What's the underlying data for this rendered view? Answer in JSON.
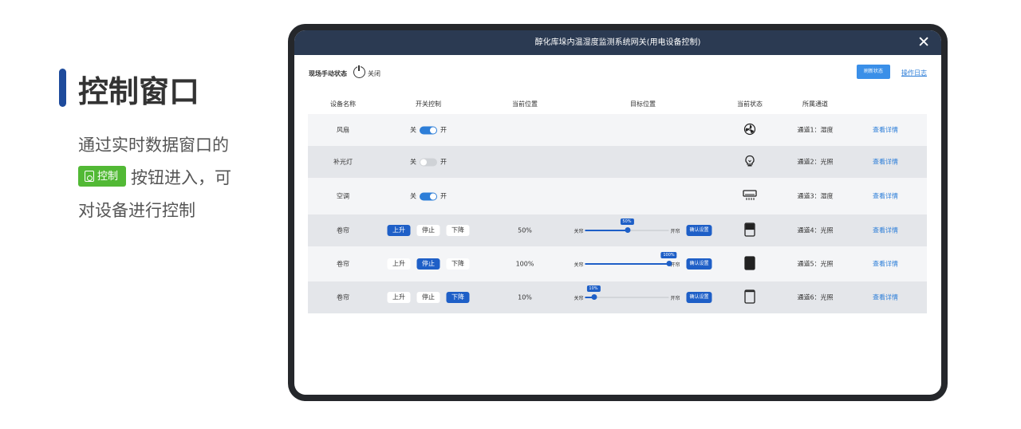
{
  "intro": {
    "title": "控制窗口",
    "line1": "通过实时数据窗口的",
    "badge_label": "控制",
    "line2_rest": "按钮进入，可",
    "line3": "对设备进行控制"
  },
  "window": {
    "title": "醇化库垛内温湿度监测系统网关(用电设备控制)",
    "close_icon": "close-icon"
  },
  "toolbar": {
    "mode_label": "现场手动状态",
    "mode_value": "关闭",
    "refresh_label": "刷新状态",
    "log_label": "操作日志"
  },
  "table": {
    "headers": [
      "设备名称",
      "开关控制",
      "当前位置",
      "目标位置",
      "当前状态",
      "所属通道"
    ],
    "rows": [
      {
        "name": "风扇",
        "type": "switch",
        "off": "关",
        "on": "开",
        "switch_on": true,
        "icon": "fan-icon",
        "channel": "通道1：湿度",
        "detail": "查看详情"
      },
      {
        "name": "补光灯",
        "type": "switch",
        "off": "关",
        "on": "开",
        "switch_on": false,
        "icon": "bulb-icon",
        "channel": "通道2：光照",
        "detail": "查看详情"
      },
      {
        "name": "空调",
        "type": "switch",
        "off": "关",
        "on": "开",
        "switch_on": true,
        "icon": "aircon-icon",
        "channel": "通道3：湿度",
        "detail": "查看详情"
      },
      {
        "name": "卷帘",
        "type": "curtain",
        "up": "上升",
        "stop": "停止",
        "down": "下降",
        "active": "up",
        "position": "50%",
        "target_percent": 50,
        "tip": "50%",
        "close_label": "关帘",
        "open_label": "开帘",
        "confirm": "确认设置",
        "icon": "curtain-half-icon",
        "channel": "通道4：光照",
        "detail": "查看详情"
      },
      {
        "name": "卷帘",
        "type": "curtain",
        "up": "上升",
        "stop": "停止",
        "down": "下降",
        "active": "stop",
        "position": "100%",
        "target_percent": 100,
        "tip": "100%",
        "close_label": "关帘",
        "open_label": "开帘",
        "confirm": "确认设置",
        "icon": "curtain-full-icon",
        "channel": "通道5：光照",
        "detail": "查看详情"
      },
      {
        "name": "卷帘",
        "type": "curtain",
        "up": "上升",
        "stop": "停止",
        "down": "下降",
        "active": "down",
        "position": "10%",
        "target_percent": 10,
        "tip": "10%",
        "close_label": "关帘",
        "open_label": "开帘",
        "confirm": "确认设置",
        "icon": "curtain-low-icon",
        "channel": "通道6：光照",
        "detail": "查看详情"
      }
    ]
  },
  "colors": {
    "accent": "#1e5fc7",
    "titlebar": "#2b3a52",
    "badge": "#52b935",
    "link": "#2d7ed8"
  }
}
